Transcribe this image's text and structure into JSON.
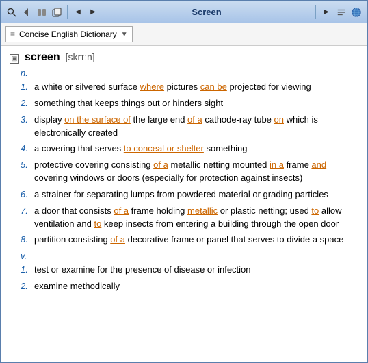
{
  "window": {
    "title": "Screen"
  },
  "toolbar": {
    "dictionary_label": "Concise English Dictionary",
    "dropdown_arrow": "▼"
  },
  "entry": {
    "icon_label": "▣",
    "word": "screen",
    "pronunciation": "[skrɪːn]",
    "pos_noun": "n.",
    "pos_verb": "v.",
    "noun_definitions": [
      {
        "number": "1.",
        "text": "a white or silvered surface where pictures can be projected for viewing",
        "highlights": [
          "where",
          "can be"
        ]
      },
      {
        "number": "2.",
        "text": "something that keeps things out or hinders sight"
      },
      {
        "number": "3.",
        "text": "display on the surface of the large end of a cathode-ray tube on which is electronically created",
        "highlights": [
          "on the surface of",
          "of a",
          "on"
        ]
      },
      {
        "number": "4.",
        "text": "a covering that serves to conceal or shelter something",
        "highlights": [
          "to conceal or shelter"
        ]
      },
      {
        "number": "5.",
        "text": "protective covering consisting of a metallic netting mounted in a frame and covering windows or doors (especially for protection against insects)",
        "highlights": [
          "of a metallic",
          "in a",
          "and covering"
        ]
      },
      {
        "number": "6.",
        "text": "a strainer for separating lumps from powdered material or grading particles"
      },
      {
        "number": "7.",
        "text": "a door that consists of a frame holding metallic or plastic netting; used to allow ventilation and to keep insects from entering a building through the open door",
        "highlights": [
          "of a frame holding metallic",
          "to allow",
          "and to keep",
          "from entering a",
          "through the open door"
        ]
      },
      {
        "number": "8.",
        "text": "partition consisting of a decorative frame or panel that serves to divide a space",
        "highlights": [
          "of a decorative",
          "that serves to"
        ]
      }
    ],
    "verb_definitions": [
      {
        "number": "1.",
        "text": "test or examine for the presence of disease or infection"
      },
      {
        "number": "2.",
        "text": "examine methodically"
      }
    ]
  }
}
